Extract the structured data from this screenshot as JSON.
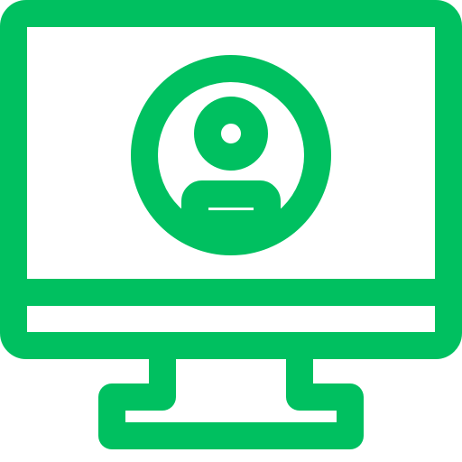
{
  "icon": {
    "name": "desktop-user-profile-icon",
    "color": "#00C060",
    "background": "#FFFFFF"
  }
}
